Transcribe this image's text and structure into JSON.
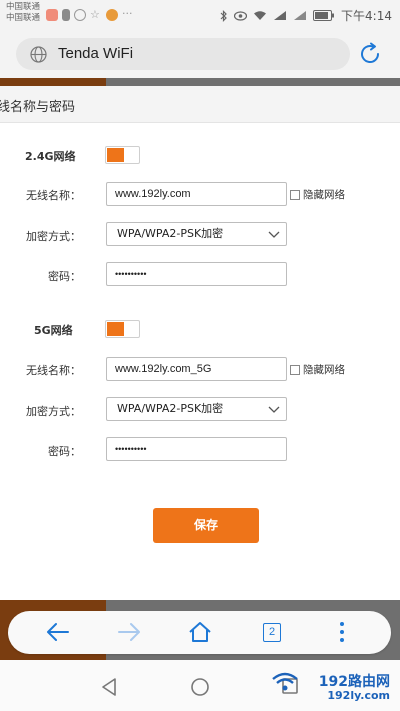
{
  "statusbar": {
    "carrier1": "中国联通",
    "carrier2": "中国联通",
    "time": "下午4:14"
  },
  "browser": {
    "url_text": "Tenda WiFi"
  },
  "section": {
    "title": "线名称与密码"
  },
  "band_24": {
    "label": "2.4G网络",
    "enabled": true,
    "ssid_label": "无线名称：",
    "ssid_value": "www.192ly.com",
    "hide_label": "隐藏网络",
    "encrypt_label": "加密方式：",
    "encrypt_value": "WPA/WPA2-PSK加密",
    "password_label": "密码：",
    "password_value": "••••••••••"
  },
  "band_5": {
    "label": "5G网络",
    "enabled": true,
    "ssid_label": "无线名称：",
    "ssid_value": "www.192ly.com_5G",
    "hide_label": "隐藏网络",
    "encrypt_label": "加密方式：",
    "encrypt_value": "WPA/WPA2-PSK加密",
    "password_label": "密码：",
    "password_value": "••••••••••"
  },
  "save_label": "保存",
  "browser_nav": {
    "tab_count": "2"
  },
  "watermark": {
    "top": "192路由网",
    "bottom": "192ly.com"
  },
  "colors": {
    "accent": "#ee7419",
    "link_blue": "#1e78d6"
  }
}
